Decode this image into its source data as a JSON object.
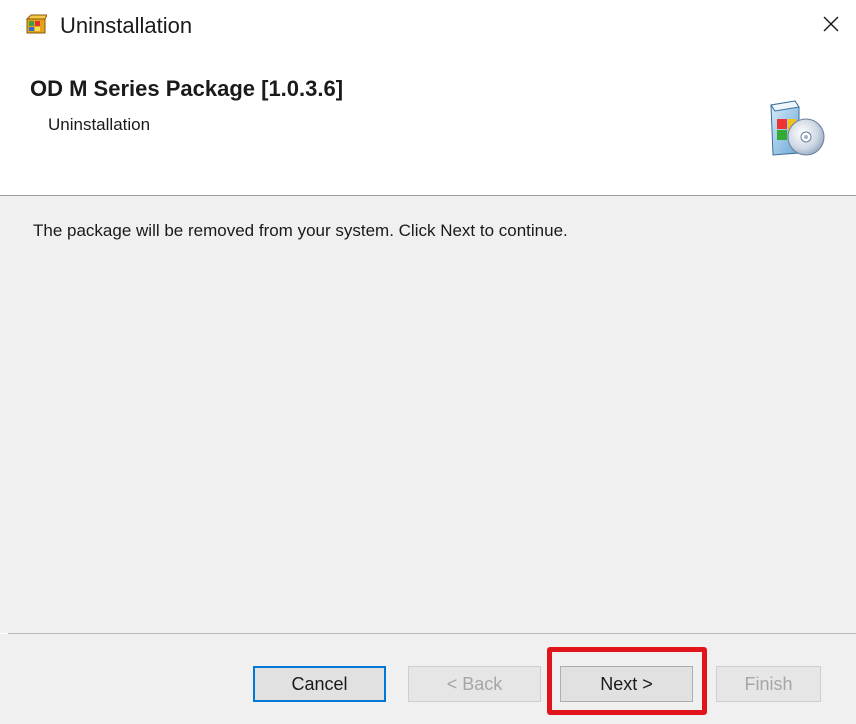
{
  "window": {
    "title": "Uninstallation",
    "close_glyph": "✕",
    "icon": "package-box-icon"
  },
  "header": {
    "title": "OD M Series Package [1.0.3.6]",
    "subtitle": "Uninstallation",
    "icon": "software-box-cd-icon"
  },
  "content": {
    "message": "The package will be removed from your system. Click Next to continue."
  },
  "buttons": {
    "cancel": "Cancel",
    "back": "< Back",
    "next": "Next >",
    "finish": "Finish"
  },
  "colors": {
    "highlight": "#e1141b",
    "focus_border": "#0078d7",
    "panel_bg": "#f0f0f0"
  }
}
